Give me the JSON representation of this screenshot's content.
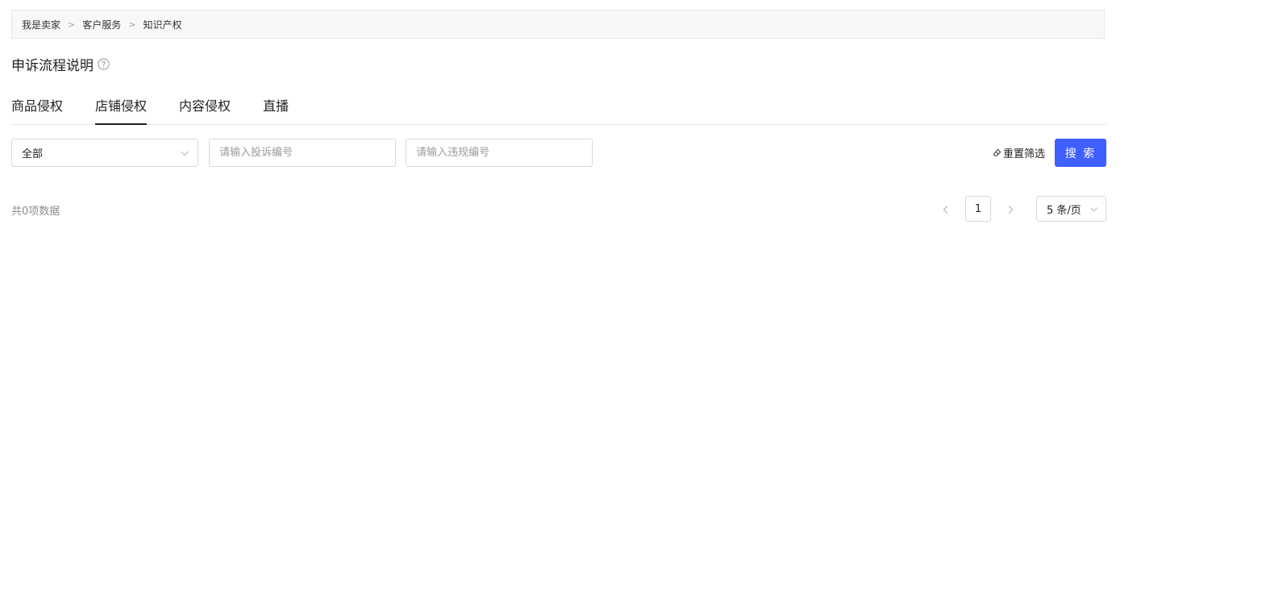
{
  "breadcrumb": {
    "items": [
      "我是卖家",
      "客户服务",
      "知识产权"
    ],
    "separator": ">"
  },
  "page_title": "申诉流程说明",
  "tabs": [
    {
      "label": "商品侵权",
      "active": false
    },
    {
      "label": "店铺侵权",
      "active": true
    },
    {
      "label": "内容侵权",
      "active": false
    },
    {
      "label": "直播",
      "active": false
    }
  ],
  "filters": {
    "type_select": {
      "value": "全部"
    },
    "complaint_no": {
      "placeholder": "请输入投诉编号",
      "value": ""
    },
    "violation_no": {
      "placeholder": "请输入违规编号",
      "value": ""
    },
    "reset_label": "重置筛选",
    "search_label": "搜 索"
  },
  "results": {
    "total_text": "共0项数据"
  },
  "pagination": {
    "current_page": "1",
    "page_size_label": "5 条/页"
  },
  "colors": {
    "primary": "#3f5fff",
    "breadcrumb_bg": "#f8f8f8",
    "border": "#d9d9d9",
    "muted_text": "#8c8c8c"
  },
  "icons": {
    "help": "question-circle-icon",
    "dropdown": "chevron-down-icon",
    "reset": "eraser-icon",
    "prev": "chevron-left-icon",
    "next": "chevron-right-icon"
  }
}
